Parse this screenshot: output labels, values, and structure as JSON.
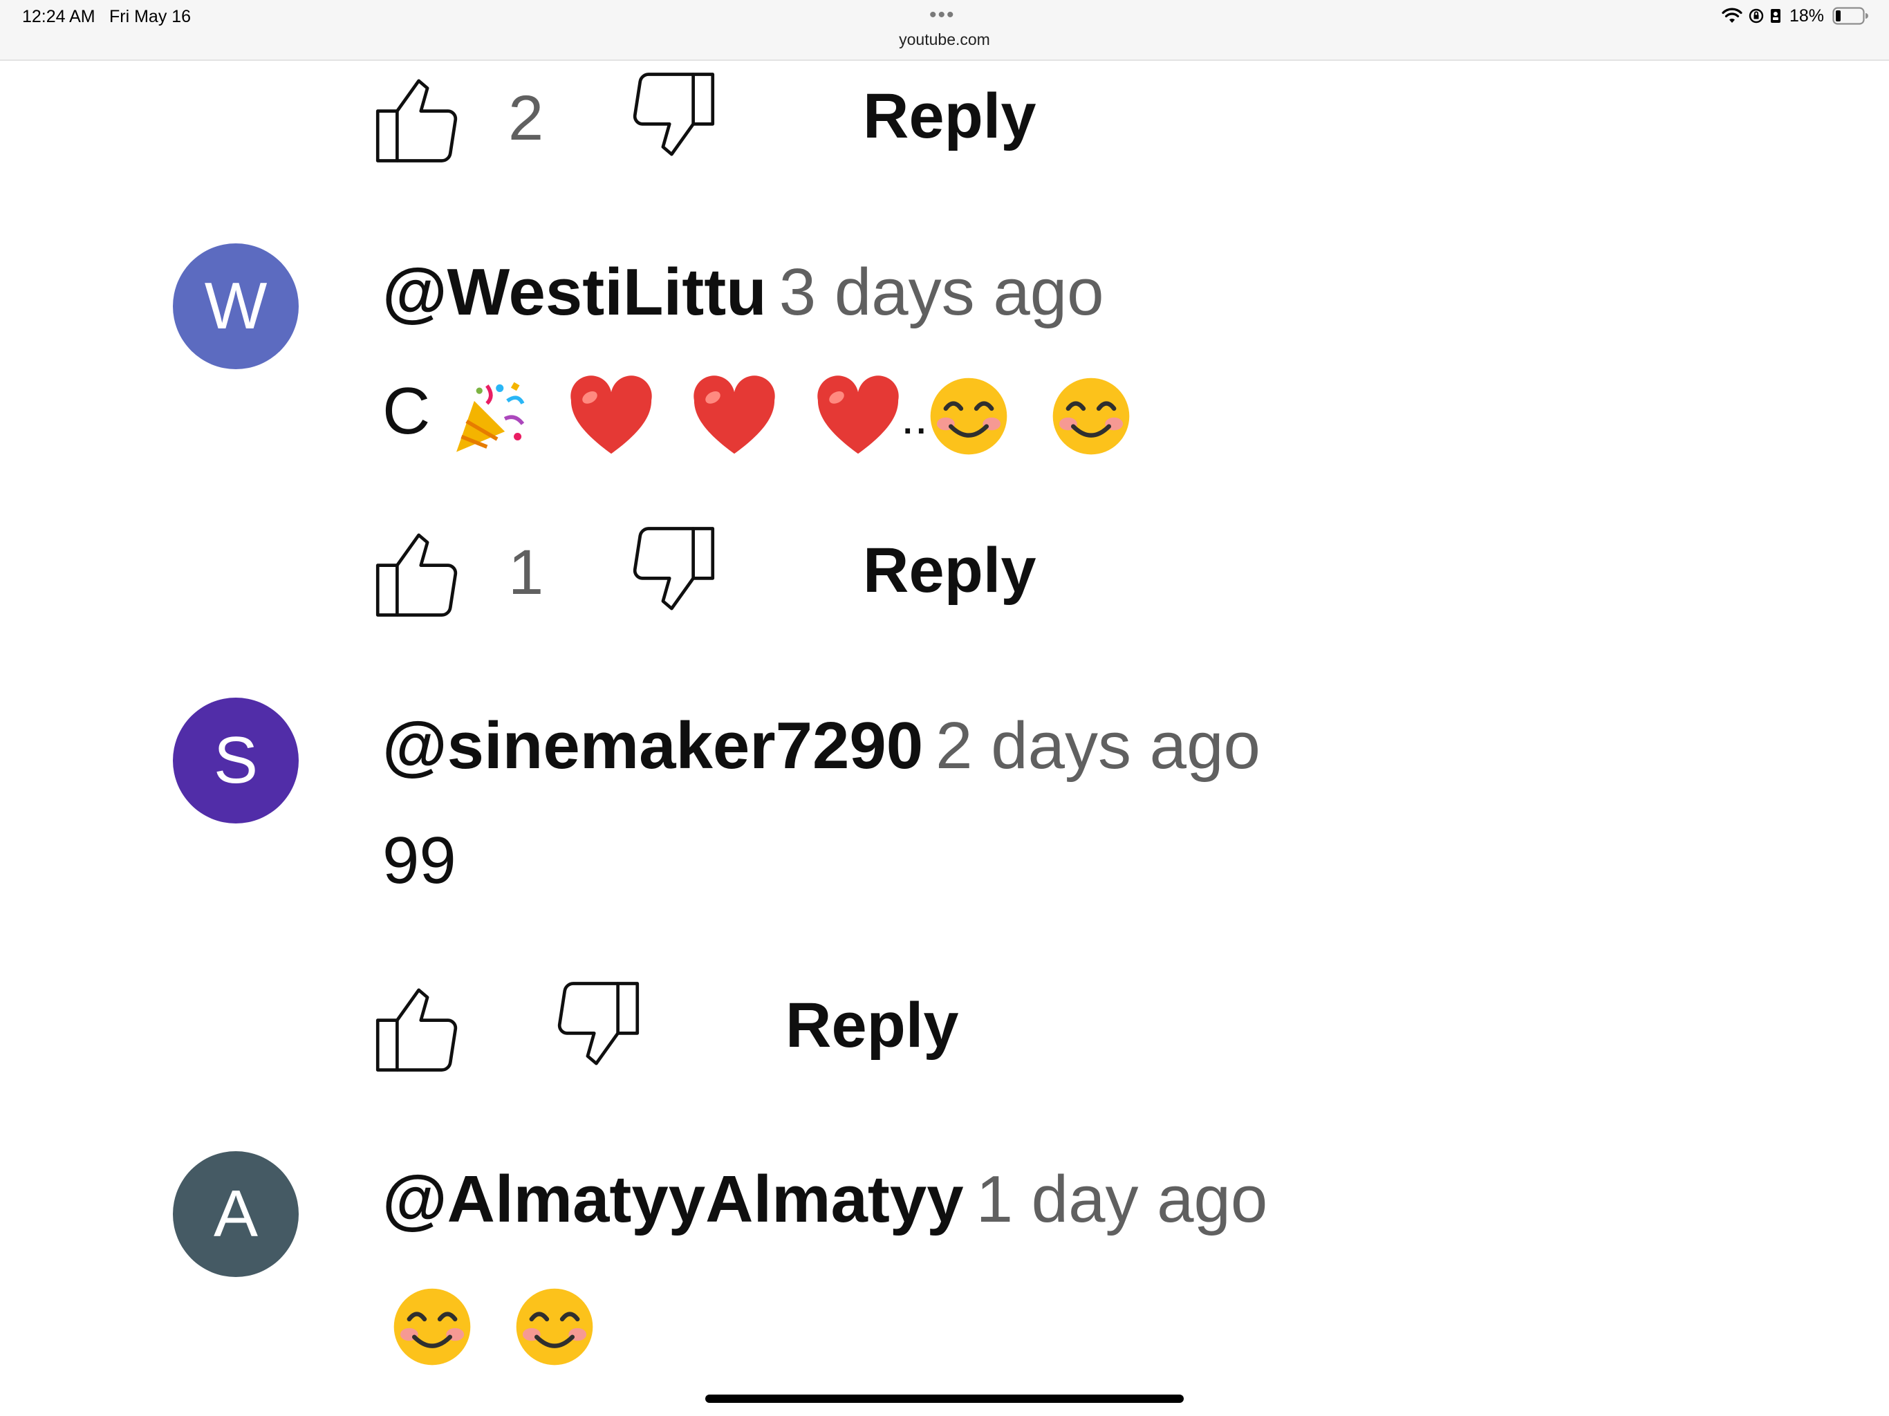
{
  "status_bar": {
    "time": "12:24 AM",
    "date": "Fri May 16",
    "url": "youtube.com",
    "battery": "18%",
    "icons": [
      "wifi-icon",
      "orientation-lock-icon",
      "battery-icon"
    ]
  },
  "comments_top": {
    "like_count": "2",
    "reply_label": "Reply"
  },
  "comments": [
    {
      "avatar_letter": "W",
      "avatar_color": "#5c6bc0",
      "author": "@WestiLittu",
      "time": "3 days ago",
      "text_prefix": "C",
      "emoji": [
        "party-popper",
        "red-heart",
        "red-heart",
        "red-heart",
        "smiling-face",
        "smiling-face"
      ],
      "dots": "..",
      "like_count": "1",
      "reply_label": "Reply"
    },
    {
      "avatar_letter": "S",
      "avatar_color": "#512da8",
      "author": "@sinemaker7290",
      "time": "2 days ago",
      "text": "99",
      "like_count": "",
      "reply_label": "Reply"
    },
    {
      "avatar_letter": "A",
      "avatar_color": "#455a64",
      "author": "@AlmatyyAlmatyy",
      "time": "1 day ago",
      "emoji": [
        "smiling-face",
        "smiling-face"
      ]
    }
  ]
}
